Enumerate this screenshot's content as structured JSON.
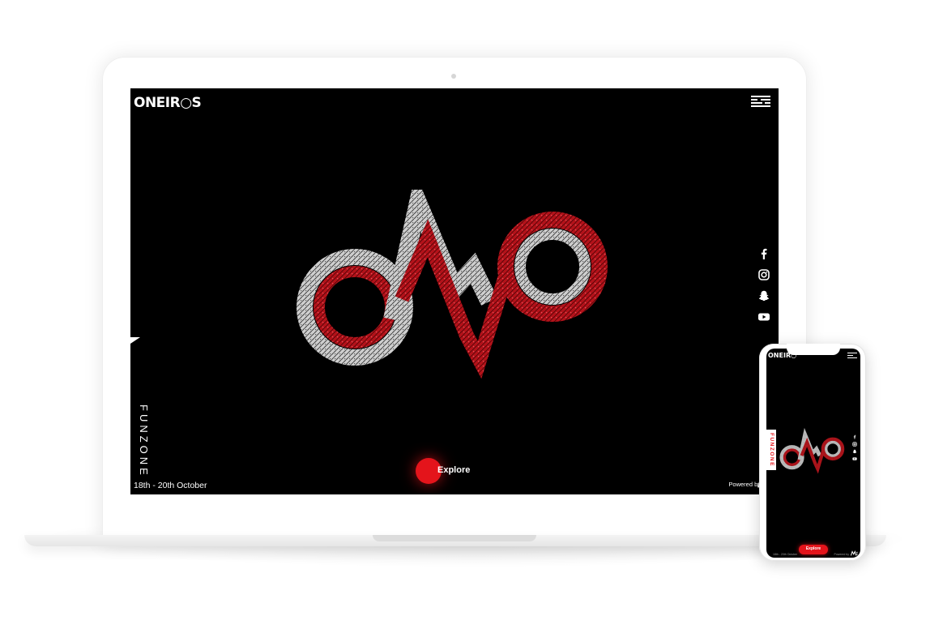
{
  "desktop": {
    "logo_text": "ONEIR○S",
    "side_tab_label": "FUNZONE",
    "social_icons": [
      "facebook-icon",
      "instagram-icon",
      "snapchat-icon",
      "youtube-icon"
    ],
    "explore_label": "Explore",
    "dates": "18th - 20th October",
    "powered_by": "Powered by"
  },
  "mobile": {
    "logo_text": "ONEIR○",
    "side_tab_label": "FUNZONE",
    "explore_label": "Explore",
    "dates": "18th - 20th October",
    "powered_by": "Powered by"
  },
  "colors": {
    "accent_red": "#e4141b",
    "background": "#000000",
    "text": "#ffffff",
    "logo_grey": "#bdbdbd"
  }
}
